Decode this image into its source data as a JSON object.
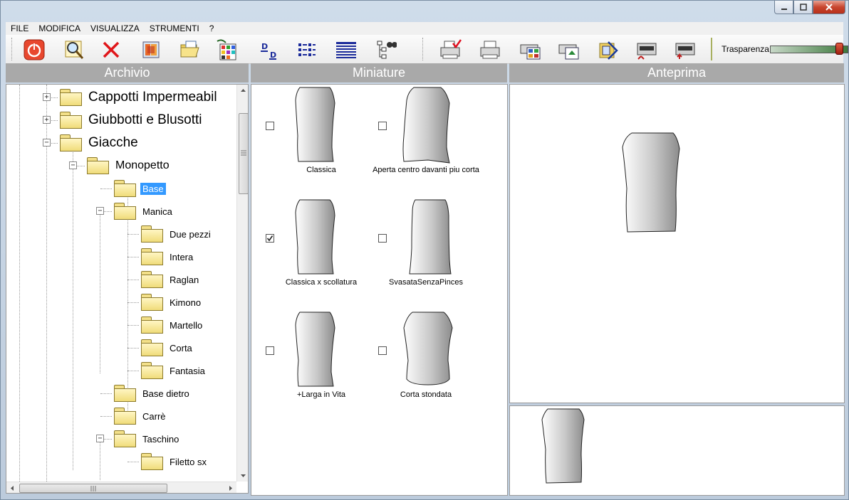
{
  "menu": {
    "items": [
      "FILE",
      "MODIFICA",
      "VISUALIZZA",
      "STRUMENTI",
      "?"
    ]
  },
  "toolbar": {
    "transparency_label": "Trasparenza",
    "transparency_level": 0.95
  },
  "panels": {
    "archive": "Archivio",
    "thumbnails": "Miniature",
    "preview": "Anteprima"
  },
  "tree": {
    "items": [
      {
        "label": "Cappotti Impermeabil",
        "expander": "+"
      },
      {
        "label": "Giubbotti e Blusotti",
        "expander": "+"
      },
      {
        "label": "Giacche",
        "expander": "−"
      },
      {
        "label": "Monopetto",
        "expander": "−"
      },
      {
        "label": "Base"
      },
      {
        "label": "Manica",
        "expander": "−"
      },
      {
        "label": "Due pezzi"
      },
      {
        "label": "Intera"
      },
      {
        "label": "Raglan"
      },
      {
        "label": "Kimono"
      },
      {
        "label": "Martello"
      },
      {
        "label": "Corta"
      },
      {
        "label": "Fantasia"
      },
      {
        "label": "Base dietro"
      },
      {
        "label": "Carrè"
      },
      {
        "label": "Taschino",
        "expander": "−"
      },
      {
        "label": "Filetto sx"
      }
    ]
  },
  "thumbnails": [
    {
      "caption": "Classica",
      "checked": false
    },
    {
      "caption": "Aperta centro davanti piu corta",
      "checked": false
    },
    {
      "caption": "Classica x scollatura",
      "checked": true
    },
    {
      "caption": "SvasataSenzaPinces",
      "checked": false
    },
    {
      "caption": "+Larga in Vita",
      "checked": false
    },
    {
      "caption": "Corta stondata",
      "checked": false
    }
  ],
  "colors": {
    "selection": "#3399ff",
    "panel_header": "#a9a9a9"
  }
}
